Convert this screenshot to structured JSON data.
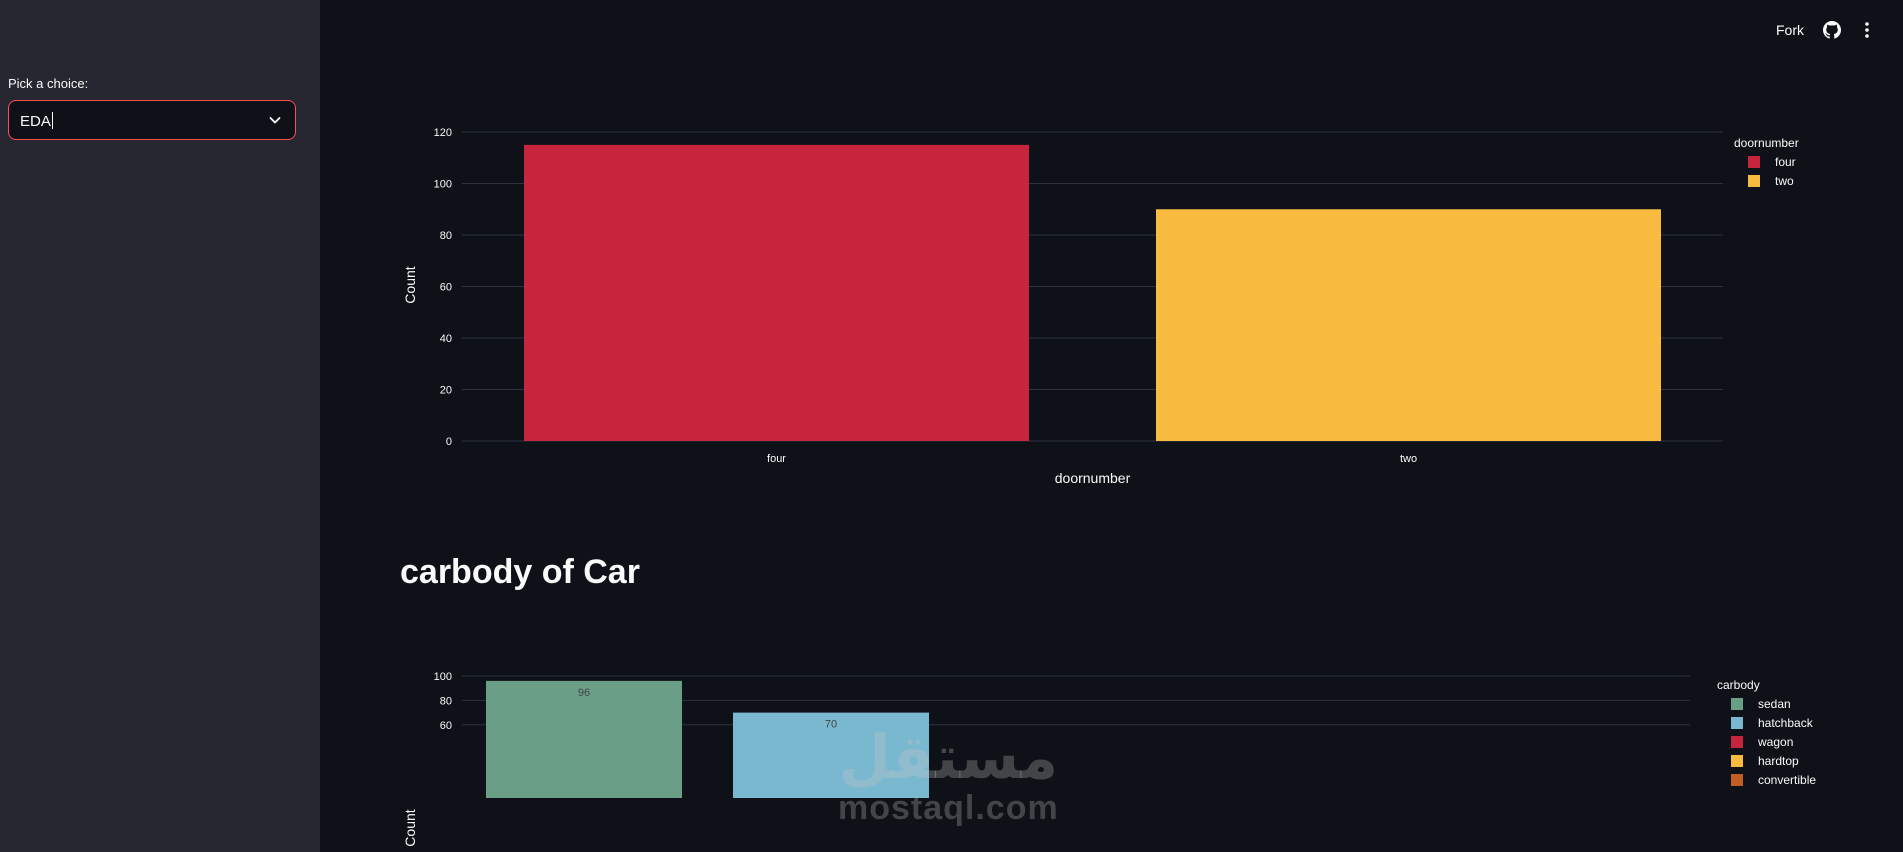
{
  "sidebar": {
    "select_label": "Pick a choice:",
    "select_value": "EDA",
    "accent_color": "#ff4b4b"
  },
  "topbar": {
    "fork_label": "Fork",
    "github_icon": "github-icon",
    "menu_icon": "kebab-menu-icon"
  },
  "section_title": "carbody of Car",
  "watermark": {
    "arabic": "مستقل",
    "latin": "mostaql.com"
  },
  "chart_data": [
    {
      "type": "bar",
      "categories": [
        "four",
        "two"
      ],
      "values": [
        115,
        90
      ],
      "colors": [
        "#c7243d",
        "#f9bb3f"
      ],
      "xlabel": "doornumber",
      "ylabel": "Count",
      "ylim": [
        0,
        120
      ],
      "yticks": [
        0,
        20,
        40,
        60,
        80,
        100,
        120
      ],
      "grid": true,
      "show_value_labels": false,
      "legend": {
        "title": "doornumber",
        "entries": [
          "four",
          "two"
        ],
        "placement": "top-right"
      }
    },
    {
      "type": "bar",
      "categories": [
        "sedan",
        "hatchback"
      ],
      "values": [
        96,
        70
      ],
      "colors": [
        "#6a9e87",
        "#7ab8cf"
      ],
      "xlabel": "",
      "ylabel": "Count",
      "ylim": [
        0,
        100
      ],
      "yticks": [
        60,
        80,
        100
      ],
      "grid": true,
      "show_value_labels": true,
      "legend": {
        "title": "carbody",
        "entries": [
          "sedan",
          "hatchback",
          "wagon",
          "hardtop",
          "convertible"
        ],
        "colors": [
          "#6a9e87",
          "#7ab8cf",
          "#c7243d",
          "#f9bb3f",
          "#c15f22"
        ],
        "placement": "top-right"
      }
    }
  ]
}
